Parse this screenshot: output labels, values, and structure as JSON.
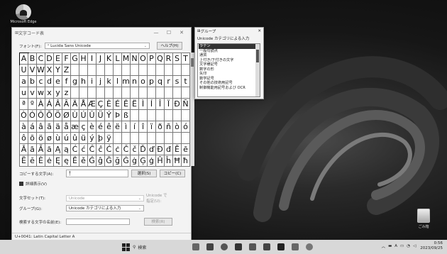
{
  "desktop": {
    "edge_label": "Microsoft Edge",
    "recycle_label": "ごみ箱"
  },
  "charmap": {
    "title": "文字コード表",
    "font_label": "フォント(F):",
    "font_value": "Lucida Sans Unicode",
    "help_button": "ヘルプ(H)",
    "rows": [
      [
        "A",
        "B",
        "C",
        "D",
        "E",
        "F",
        "G",
        "H",
        "I",
        "J",
        "K",
        "L",
        "M",
        "N",
        "O",
        "P",
        "Q",
        "R",
        "S",
        "T"
      ],
      [
        "U",
        "V",
        "W",
        "X",
        "Y",
        "Z",
        "",
        "",
        "",
        "",
        "",
        "",
        "",
        "",
        "",
        "",
        "",
        "",
        "",
        ""
      ],
      [
        "a",
        "b",
        "c",
        "d",
        "e",
        "f",
        "g",
        "h",
        "i",
        "j",
        "k",
        "l",
        "m",
        "n",
        "o",
        "p",
        "q",
        "r",
        "s",
        "t"
      ],
      [
        "u",
        "v",
        "w",
        "x",
        "y",
        "z",
        "",
        "",
        "",
        "",
        "",
        "",
        "",
        "",
        "",
        "",
        "",
        "",
        "",
        ""
      ],
      [
        "ª",
        "º",
        "À",
        "Á",
        "Â",
        "Ã",
        "Ä",
        "Å",
        "Æ",
        "Ç",
        "È",
        "É",
        "Ê",
        "Ë",
        "Ì",
        "Í",
        "Î",
        "Ï",
        "Ð",
        "Ñ"
      ],
      [
        "Ò",
        "Ó",
        "Ô",
        "Õ",
        "Ö",
        "Ø",
        "Ù",
        "Ú",
        "Û",
        "Ü",
        "Ý",
        "Þ",
        "ß",
        "",
        "",
        "",
        "",
        "",
        "",
        ""
      ],
      [
        "à",
        "á",
        "â",
        "ã",
        "ä",
        "å",
        "æ",
        "ç",
        "è",
        "é",
        "ê",
        "ë",
        "ì",
        "í",
        "î",
        "ï",
        "ð",
        "ñ",
        "ò",
        "ó"
      ],
      [
        "ô",
        "õ",
        "ö",
        "ø",
        "ù",
        "ú",
        "û",
        "ü",
        "ý",
        "þ",
        "ÿ",
        "",
        "",
        "",
        "",
        "",
        "",
        "",
        "",
        ""
      ],
      [
        "Ā",
        "ā",
        "Ă",
        "ă",
        "Ą",
        "ą",
        "Ć",
        "ć",
        "Ĉ",
        "ĉ",
        "Ċ",
        "ċ",
        "Č",
        "č",
        "Ď",
        "ď",
        "Đ",
        "đ",
        "Ē",
        "ē"
      ],
      [
        "Ĕ",
        "ĕ",
        "Ė",
        "ė",
        "Ę",
        "ę",
        "Ě",
        "ě",
        "Ĝ",
        "ĝ",
        "Ğ",
        "ğ",
        "Ġ",
        "ġ",
        "Ģ",
        "ģ",
        "Ĥ",
        "ĥ",
        "Ħ",
        "ħ"
      ]
    ],
    "copy_label": "コピーする文字(A):",
    "copy_value": "!",
    "select_button": "選択(S)",
    "copy_button": "コピー(C)",
    "advanced_label": "詳細表示(V)",
    "charset_label": "文字セット(T):",
    "charset_value": "Unicode",
    "goto_unicode": "Unicode で指定(U):",
    "group_label": "グループ(G):",
    "group_value": "Unicode カテゴリによる入力",
    "search_label": "検索する文字の名前(E):",
    "search_button": "検索(R)",
    "status": "U+0041: Latin Capital Letter A"
  },
  "group_popup": {
    "title": "グループ",
    "heading": "Unicode カテゴリによる入力",
    "items": [
      "ラテン",
      "一般句読点",
      "通貨",
      "上付き/下付きの文字",
      "文字様記号",
      "数字の形",
      "矢印",
      "数学記号",
      "その他の技術用記号",
      "制御機能用記号および OCR"
    ]
  },
  "taskbar": {
    "search_label": "検索",
    "lang": "A",
    "time": "0:56",
    "date": "2023/09/25"
  }
}
